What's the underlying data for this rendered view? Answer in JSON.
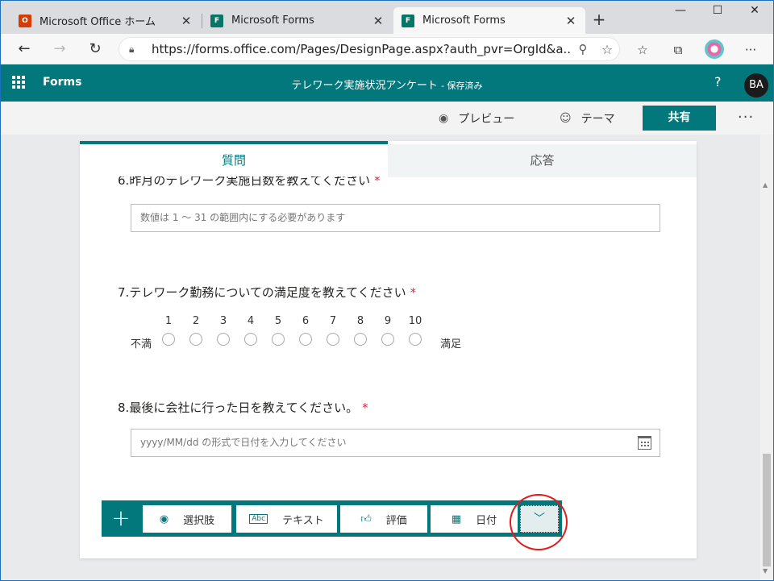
{
  "browser": {
    "tabs": [
      {
        "title": "Microsoft Office ホーム",
        "icon": "office-icon",
        "active": false
      },
      {
        "title": "Microsoft Forms",
        "icon": "forms-icon",
        "active": false
      },
      {
        "title": "Microsoft Forms",
        "icon": "forms-icon",
        "active": true
      }
    ],
    "url": "https://forms.office.com/Pages/DesignPage.aspx?auth_pvr=OrgId&a..."
  },
  "header": {
    "app_name": "Forms",
    "doc_title": "テレワーク実施状況アンケート",
    "saved_status": "- 保存済み",
    "help": "?",
    "avatar_initials": "BA"
  },
  "commands": {
    "preview": "プレビュー",
    "theme": "テーマ",
    "share": "共有",
    "more": "···"
  },
  "tabs": {
    "questions": "質問",
    "responses": "応答"
  },
  "questions": [
    {
      "number": "6.",
      "text": "昨月のテレワーク実施日数を教えてください",
      "required": "*",
      "placeholder": "数値は 1 ～ 31 の範囲内にする必要があります"
    },
    {
      "number": "7.",
      "text": "テレワーク勤務についての満足度を教えてください",
      "required": "*",
      "low_label": "不満",
      "high_label": "満足",
      "scale": [
        "1",
        "2",
        "3",
        "4",
        "5",
        "6",
        "7",
        "8",
        "9",
        "10"
      ]
    },
    {
      "number": "8.",
      "text": "最後に会社に行った日を教えてください。",
      "required": "*",
      "placeholder": "yyyy/MM/dd の形式で日付を入力してください"
    }
  ],
  "add_toolbar": {
    "choice": "選択肢",
    "text": "テキスト",
    "rating": "評価",
    "date": "日付"
  },
  "colors": {
    "accent": "#03787c",
    "required": "#c4314b",
    "highlight": "#e11a1a"
  }
}
